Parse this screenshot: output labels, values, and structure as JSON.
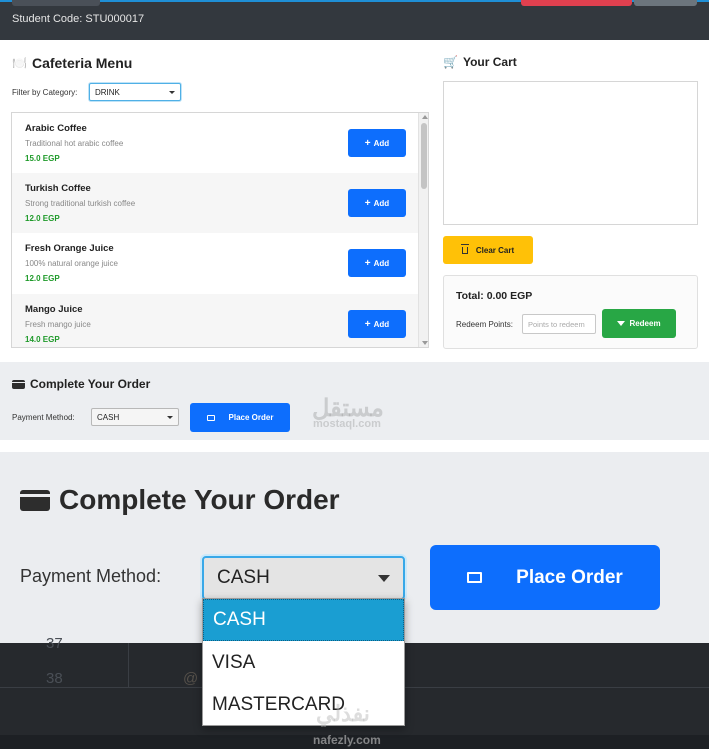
{
  "header": {
    "student_code": "Student Code: STU000017"
  },
  "menu": {
    "title_icon": "🍽️",
    "title": "Cafeteria Menu",
    "filter_label": "Filter by Category:",
    "filter_value": "DRINK",
    "add_label": "Add",
    "items": [
      {
        "name": "Arabic Coffee",
        "description": "Traditional hot arabic coffee",
        "price": "15.0 EGP"
      },
      {
        "name": "Turkish Coffee",
        "description": "Strong traditional turkish coffee",
        "price": "12.0 EGP"
      },
      {
        "name": "Fresh Orange Juice",
        "description": "100% natural orange juice",
        "price": "12.0 EGP"
      },
      {
        "name": "Mango Juice",
        "description": "Fresh mango juice",
        "price": "14.0 EGP"
      }
    ]
  },
  "cart": {
    "title_icon": "🛒",
    "title": "Your Cart",
    "clear_label": "Clear Cart",
    "total": "Total: 0.00 EGP",
    "redeem_label": "Redeem Points:",
    "redeem_placeholder": "Points to redeem",
    "redeem_button": "Redeem"
  },
  "order": {
    "title": "Complete Your Order",
    "payment_label": "Payment Method:",
    "payment_value": "CASH",
    "place_order_label": "Place Order",
    "payment_options": [
      "CASH",
      "VISA",
      "MASTERCARD"
    ]
  },
  "background_fragments": {
    "num_1": "37",
    "num_2": "38",
    "frag": "@"
  },
  "watermarks": {
    "mostaql_ar": "مستقل",
    "mostaql_en": "mostaql.com",
    "nafezly_ar": "نفذلي",
    "nafezly_en": "nafezly.com"
  }
}
